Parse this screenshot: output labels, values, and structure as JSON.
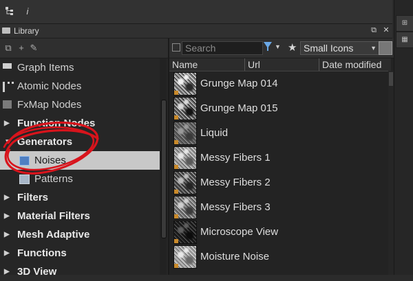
{
  "toolbar": {
    "icons": [
      "hierarchy-icon",
      "info-icon"
    ],
    "info_glyph": "i"
  },
  "panel": {
    "title": "Library"
  },
  "tree": [
    {
      "label": "Graph Items",
      "bold": false,
      "arrow": "",
      "icon": "graph-items-icon"
    },
    {
      "label": "Atomic Nodes",
      "bold": false,
      "arrow": "",
      "icon": "atomic-nodes-icon"
    },
    {
      "label": "FxMap Nodes",
      "bold": false,
      "arrow": "",
      "icon": "fxmap-icon"
    },
    {
      "label": "Function Nodes",
      "bold": true,
      "arrow": "▶",
      "icon": ""
    },
    {
      "label": "Generators",
      "bold": true,
      "arrow": "▼",
      "icon": ""
    },
    {
      "label": "Noises",
      "bold": false,
      "arrow": "",
      "icon": "noises-icon",
      "selected": true
    },
    {
      "label": "Patterns",
      "bold": false,
      "arrow": "",
      "icon": "patterns-icon"
    },
    {
      "label": "Filters",
      "bold": true,
      "arrow": "▶",
      "icon": ""
    },
    {
      "label": "Material Filters",
      "bold": true,
      "arrow": "▶",
      "icon": ""
    },
    {
      "label": "Mesh Adaptive",
      "bold": true,
      "arrow": "▶",
      "icon": ""
    },
    {
      "label": "Functions",
      "bold": true,
      "arrow": "▶",
      "icon": ""
    },
    {
      "label": "3D View",
      "bold": true,
      "arrow": "▶",
      "icon": ""
    }
  ],
  "search": {
    "placeholder": "Search"
  },
  "view_mode": "Small Icons",
  "columns": [
    "Name",
    "Url",
    "Date modified"
  ],
  "items": [
    {
      "name": "Grunge Map 014"
    },
    {
      "name": "Grunge Map 015"
    },
    {
      "name": "Liquid"
    },
    {
      "name": "Messy Fibers 1"
    },
    {
      "name": "Messy Fibers 2"
    },
    {
      "name": "Messy Fibers 3"
    },
    {
      "name": "Microscope View"
    },
    {
      "name": "Moisture Noise"
    }
  ],
  "colors": {
    "selected_row": "#c8c8c8",
    "annotation": "#d8141c",
    "filter": "#6aa8e6"
  }
}
